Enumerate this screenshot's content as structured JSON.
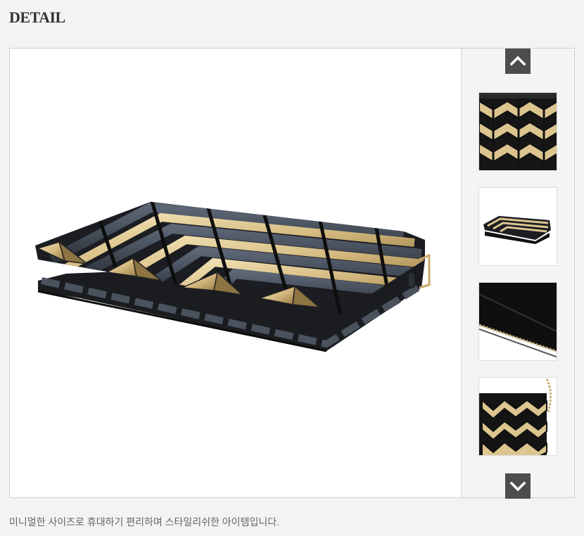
{
  "section": {
    "title": "DETAIL"
  },
  "gallery": {
    "prev_icon": "chevron-up-icon",
    "next_icon": "chevron-down-icon",
    "thumbnails": [
      {
        "name": "pattern-closeup"
      },
      {
        "name": "clutch-side-view"
      },
      {
        "name": "interior-zipper"
      },
      {
        "name": "chain-strap-view"
      }
    ]
  },
  "description": {
    "text": "미니멀한 사이즈로 휴대하기 편리하며 스타일리쉬한 아이템입니다."
  },
  "colors": {
    "gold": "#d8c08a",
    "black": "#151515",
    "arrow_bg": "#4d4d4d"
  }
}
